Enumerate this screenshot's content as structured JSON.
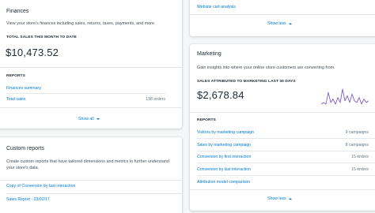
{
  "finances": {
    "title": "Finances",
    "description": "View your store's finances including sales, returns, taxes, payments, and more.",
    "metric_label": "TOTAL SALES THIS MONTH TO DATE",
    "metric_value": "$10,473.52",
    "reports_label": "REPORTS",
    "reports": [
      {
        "name": "Finances summary",
        "count": ""
      },
      {
        "name": "Total sales",
        "count": "138 orders"
      }
    ],
    "toggle_label": "Show all"
  },
  "custom_reports": {
    "title": "Custom reports",
    "description": "Create custom reports that have tailored dimensions and metrics to further understand your store's data.",
    "items": [
      "Copy of Conversion by last interaction",
      "Sales Report - 03/02/17"
    ]
  },
  "top_right": {
    "link": "Website cart analysis",
    "toggle_label": "Show less"
  },
  "marketing": {
    "title": "Marketing",
    "description": "Gain insights into where your online store customers are converting from.",
    "metric_label": "SALES ATTRIBUTED TO MARKETING LAST 30 DAYS",
    "metric_value": "$2,678.84",
    "sparkline_color": "#7c5dc7",
    "sparkline": [
      2,
      3,
      2,
      9,
      3,
      5,
      2,
      6,
      3,
      11,
      4,
      7,
      3,
      8,
      4,
      3,
      6,
      2,
      5,
      3,
      4
    ],
    "reports_label": "REPORTS",
    "reports": [
      {
        "name": "Visitors by marketing campaign",
        "count": "9 campaigns"
      },
      {
        "name": "Sales by marketing campaign",
        "count": "8 campaigns"
      },
      {
        "name": "Conversion by first interaction",
        "count": "15 orders"
      },
      {
        "name": "Conversion by last interaction",
        "count": "15 orders"
      },
      {
        "name": "Attribution model comparison",
        "count": ""
      }
    ],
    "toggle_label": "Show less"
  }
}
